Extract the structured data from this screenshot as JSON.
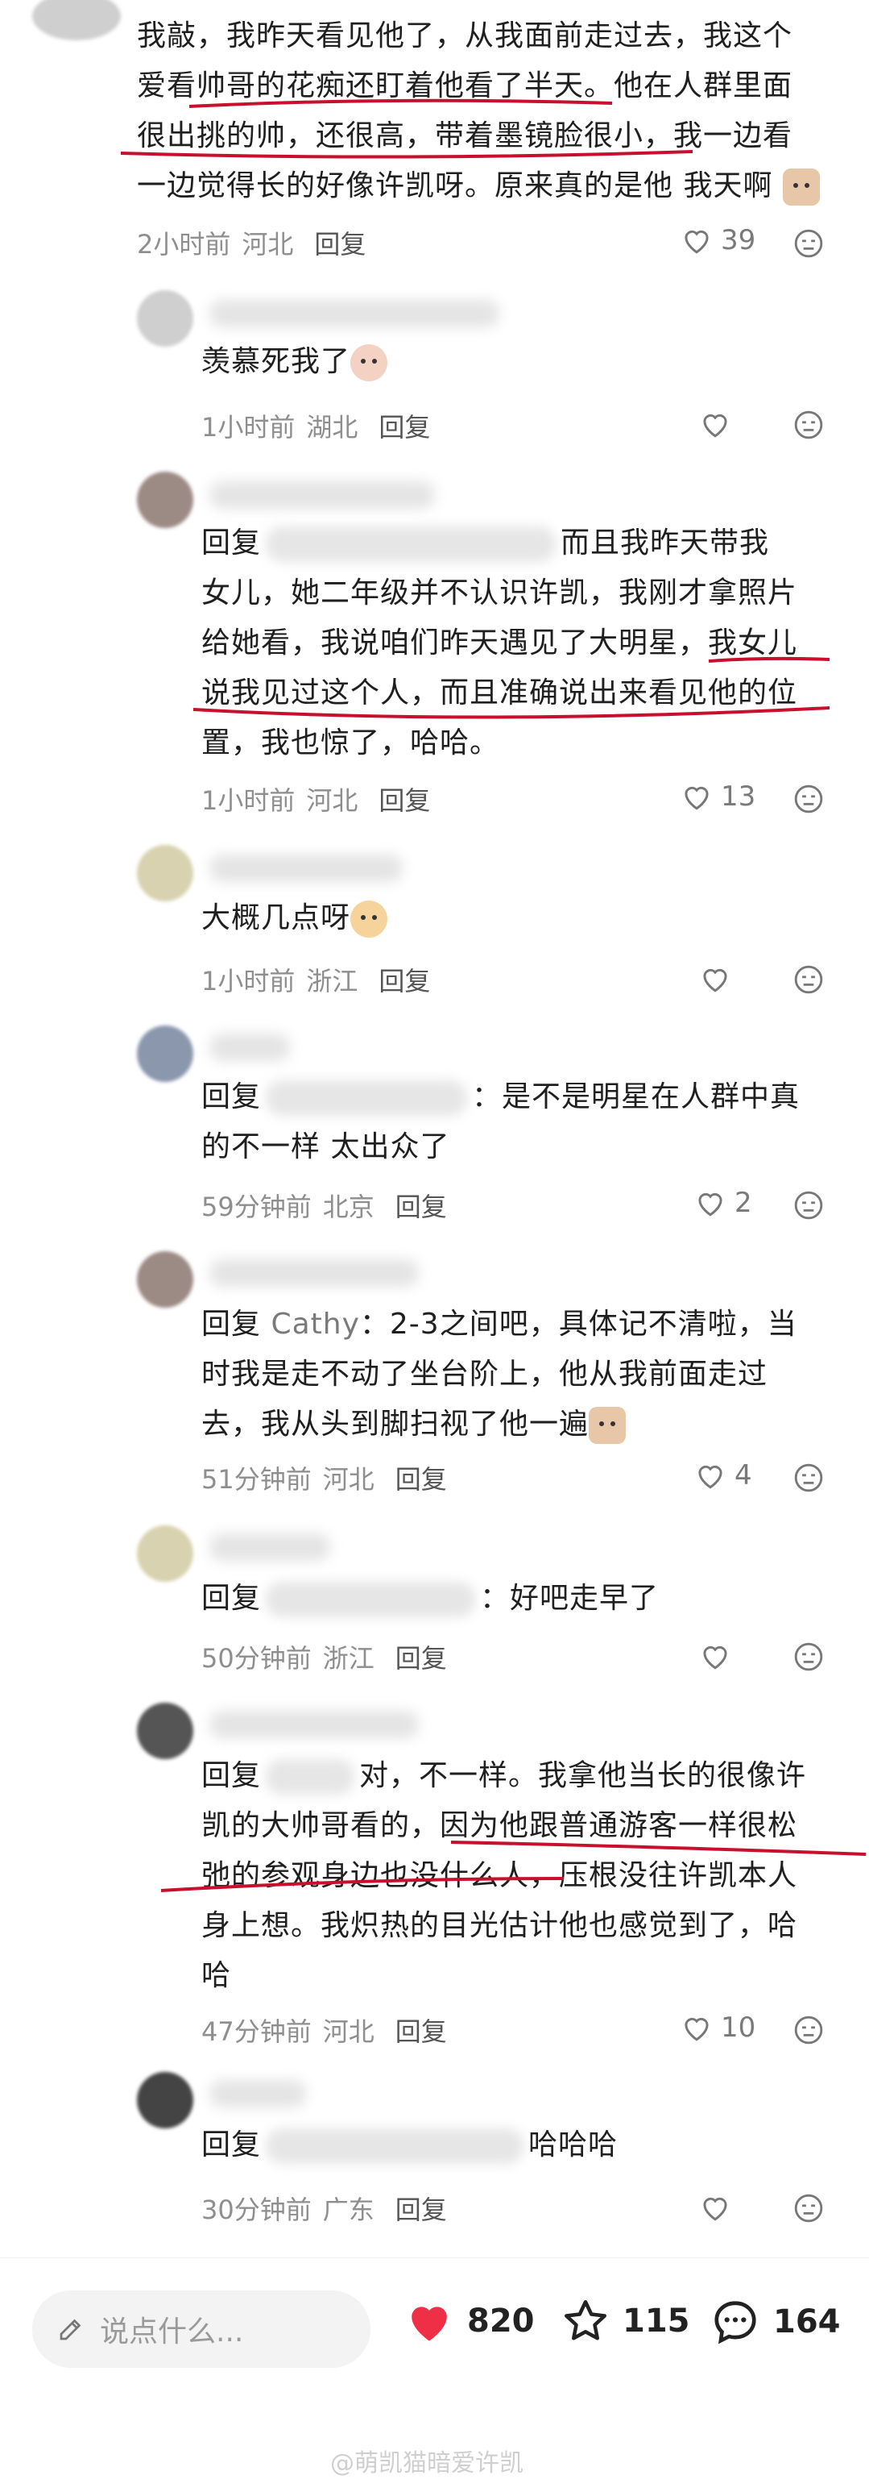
{
  "comments": [
    {
      "lines": [
        "我敲，我昨天看见他了，从我面前走过去，我这个",
        "爱看帅哥的花痴还盯着他看了半天。他在人群里面",
        "很出挑的帅，还很高，带着墨镜脸很小，我一边看",
        "一边觉得长的好像许凯呀。原来真的是他 我天啊"
      ],
      "time": "2小时前",
      "region": "河北",
      "reply": "回复",
      "likes": "39"
    },
    {
      "lines": [
        "羡慕死我了"
      ],
      "time": "1小时前",
      "region": "湖北",
      "reply": "回复",
      "likes": ""
    },
    {
      "prefix": "回复",
      "after_blur": "而且我昨天带我",
      "lines": [
        "女儿，她二年级并不认识许凯，我刚才拿照片",
        "给她看，我说咱们昨天遇见了大明星，我女儿",
        "说我见过这个人，而且准确说出来看见他的位",
        "置，我也惊了，哈哈。"
      ],
      "time": "1小时前",
      "region": "河北",
      "reply": "回复",
      "likes": "13"
    },
    {
      "lines": [
        "大概几点呀"
      ],
      "time": "1小时前",
      "region": "浙江",
      "reply": "回复",
      "likes": ""
    },
    {
      "prefix": "回复",
      "after_blur": "：是不是明星在人群中真",
      "lines": [
        "的不一样 太出众了"
      ],
      "time": "59分钟前",
      "region": "北京",
      "reply": "回复",
      "likes": "2"
    },
    {
      "prefix": "回复",
      "mention": "Cathy",
      "after_blur": "：2-3之间吧，具体记不清啦，当",
      "lines": [
        "时我是走不动了坐台阶上，他从我前面走过",
        "去，我从头到脚扫视了他一遍"
      ],
      "time": "51分钟前",
      "region": "河北",
      "reply": "回复",
      "likes": "4"
    },
    {
      "prefix": "回复",
      "after_blur": "：好吧走早了",
      "lines": [],
      "time": "50分钟前",
      "region": "浙江",
      "reply": "回复",
      "likes": ""
    },
    {
      "prefix": "回复",
      "after_blur": "对，不一样。我拿他当长的很像许",
      "lines": [
        "凯的大帅哥看的，因为他跟普通游客一样很松",
        "弛的参观身边也没什么人，压根没往许凯本人",
        "身上想。我炽热的目光估计他也感觉到了，哈",
        "哈"
      ],
      "time": "47分钟前",
      "region": "河北",
      "reply": "回复",
      "likes": "10"
    },
    {
      "prefix": "回复",
      "after_blur": "哈哈哈",
      "lines": [],
      "time": "30分钟前",
      "region": "广东",
      "reply": "回复",
      "likes": ""
    }
  ],
  "bottom_bar": {
    "placeholder": "说点什么...",
    "like_count": "820",
    "star_count": "115",
    "comment_count": "164"
  },
  "watermark": "@萌凯猫暗爱许凯",
  "colors": {
    "like_red": "#ee2f45",
    "annotation_red": "#c8102e"
  },
  "icons": [
    "heart-outline-icon",
    "dislike-face-icon",
    "pen-icon",
    "heart-filled-icon",
    "star-icon",
    "comment-bubble-icon"
  ]
}
